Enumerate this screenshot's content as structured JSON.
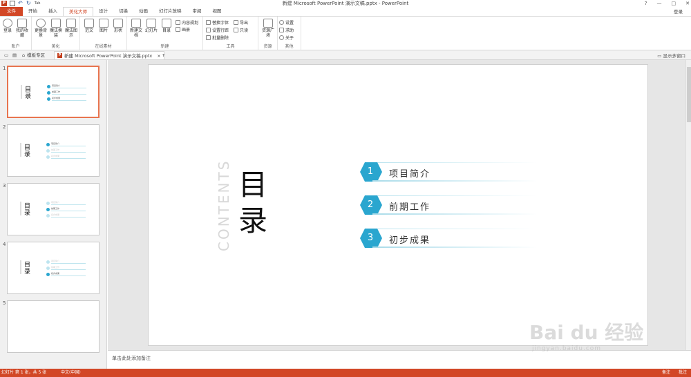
{
  "titlebar": {
    "title": "新建 Microsoft PowerPoint 演示文稿.pptx - PowerPoint",
    "qat_extra": "Tab",
    "controls": [
      "?",
      "—",
      "□",
      "✕"
    ]
  },
  "tabs": [
    "文件",
    "开始",
    "插入",
    "美化大师",
    "设计",
    "切换",
    "动画",
    "幻灯片放映",
    "审阅",
    "视图"
  ],
  "active_tab_index": 3,
  "login_label": "登录",
  "ribbon": {
    "groups": [
      {
        "label": "账户",
        "buttons": [
          "登录",
          "我的收藏"
        ]
      },
      {
        "label": "美化",
        "buttons": [
          "更换背景",
          "魔法换装",
          "魔法图示"
        ]
      },
      {
        "label": "在线素材",
        "buttons": [
          "范文",
          "图片",
          "形状"
        ]
      },
      {
        "label": "新建",
        "buttons": [
          "新建文档",
          "幻灯片",
          "目录"
        ],
        "small": [
          "内容规划",
          "画册"
        ]
      },
      {
        "label": "工具",
        "small": [
          "替换字体",
          "导出",
          "设置行距",
          "只读",
          "批量删除"
        ]
      },
      {
        "label": "资源",
        "buttons": [
          "资源广场"
        ]
      },
      {
        "label": "其他",
        "small": [
          "设置",
          "求助",
          "关于"
        ]
      }
    ]
  },
  "docbar": {
    "template_tab": "模板专区",
    "doc_tab": "新建 Microsoft PowerPoint 演示文稿.pptx",
    "close": "×",
    "add": "+",
    "right_label": "显示多窗口"
  },
  "thumbnails": [
    {
      "num": "1",
      "title": "目录",
      "active_item": -1
    },
    {
      "num": "2",
      "title": "目录",
      "active_item": 0
    },
    {
      "num": "3",
      "title": "目录",
      "active_item": 1
    },
    {
      "num": "4",
      "title": "目录",
      "active_item": 2
    },
    {
      "num": "5",
      "title": "",
      "active_item": -1
    }
  ],
  "slide": {
    "contents_word": "CONTENTS",
    "title": "目录",
    "items": [
      {
        "num": "1",
        "label": "项目简介"
      },
      {
        "num": "2",
        "label": "前期工作"
      },
      {
        "num": "3",
        "label": "初步成果"
      }
    ]
  },
  "thumb_item_labels": [
    "项目简介",
    "前期工作",
    "初步成果"
  ],
  "notes_placeholder": "单击此处添加备注",
  "status": {
    "slide_info": "幻灯片 第 1 张，共 5 张",
    "language": "中文(中国)",
    "notes": "备注",
    "comments": "批注"
  },
  "watermark": {
    "line1": "Bai du 经验",
    "line2": "jingyan.baidu.com"
  },
  "colors": {
    "accent": "#d24726",
    "hex": "#2aa6cf",
    "dim": "#bde4ef"
  }
}
